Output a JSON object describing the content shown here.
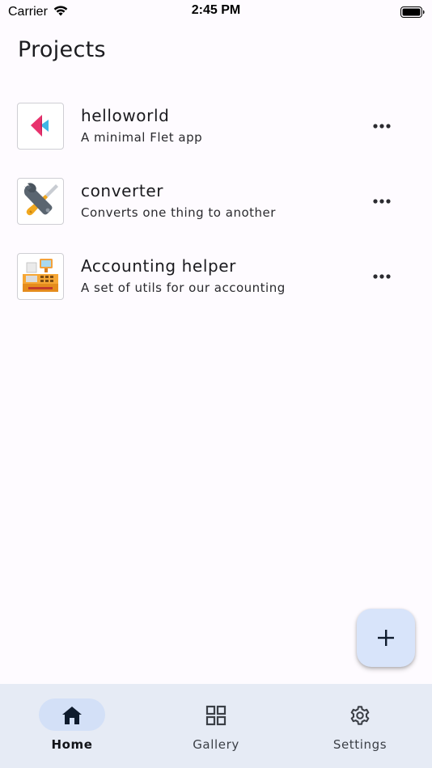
{
  "status_bar": {
    "carrier": "Carrier",
    "time": "2:45 PM"
  },
  "page": {
    "title": "Projects"
  },
  "projects": [
    {
      "name": "helloworld",
      "description": "A minimal Flet app",
      "icon": "flet-logo-icon"
    },
    {
      "name": "converter",
      "description": "Converts one thing to another",
      "icon": "wrench-screwdriver-icon"
    },
    {
      "name": "Accounting helper",
      "description": "A set of utils for our accounting",
      "icon": "cash-register-icon"
    }
  ],
  "fab": {
    "icon": "plus-icon"
  },
  "bottom_nav": {
    "items": [
      {
        "label": "Home",
        "icon": "home-icon",
        "active": true
      },
      {
        "label": "Gallery",
        "icon": "grid-icon",
        "active": false
      },
      {
        "label": "Settings",
        "icon": "gear-icon",
        "active": false
      }
    ]
  },
  "colors": {
    "background": "#fefbff",
    "fab": "#d8e4fa",
    "nav_bar": "#e6ebf5",
    "nav_indicator": "#d3e0f7"
  }
}
